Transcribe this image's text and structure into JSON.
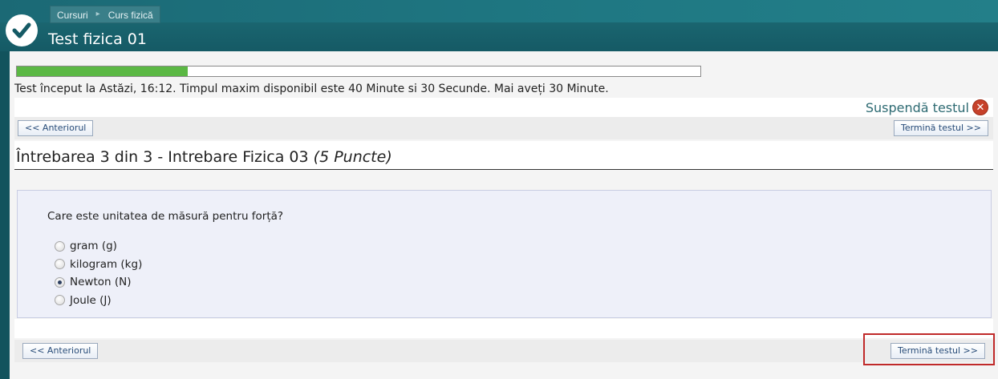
{
  "header": {
    "breadcrumbs": [
      "Cursuri",
      "Curs fizică"
    ],
    "title": "Test fizica 01"
  },
  "progress": {
    "fraction": 0.25
  },
  "info_text": "Test început la Astăzi, 16:12. Timpul maxim disponibil este 40 Minute si 30 Secunde. Mai aveți 30 Minute.",
  "suspend_label": "Suspendă testul",
  "nav": {
    "prev_label": "<< Anteriorul",
    "finish_label": "Termină testul >>"
  },
  "question": {
    "heading": "Întrebarea 3 din 3 - Intrebare Fizica 03",
    "points": "(5 Puncte)",
    "text": "Care este unitatea de măsură pentru forță?",
    "options": [
      {
        "label": "gram (g)",
        "checked": false
      },
      {
        "label": "kilogram (kg)",
        "checked": false
      },
      {
        "label": "Newton (N)",
        "checked": true
      },
      {
        "label": "Joule (J)",
        "checked": false
      }
    ]
  },
  "colors": {
    "header": "#155a65",
    "progress_fill": "#5bb844",
    "highlight": "#c02a2a"
  }
}
